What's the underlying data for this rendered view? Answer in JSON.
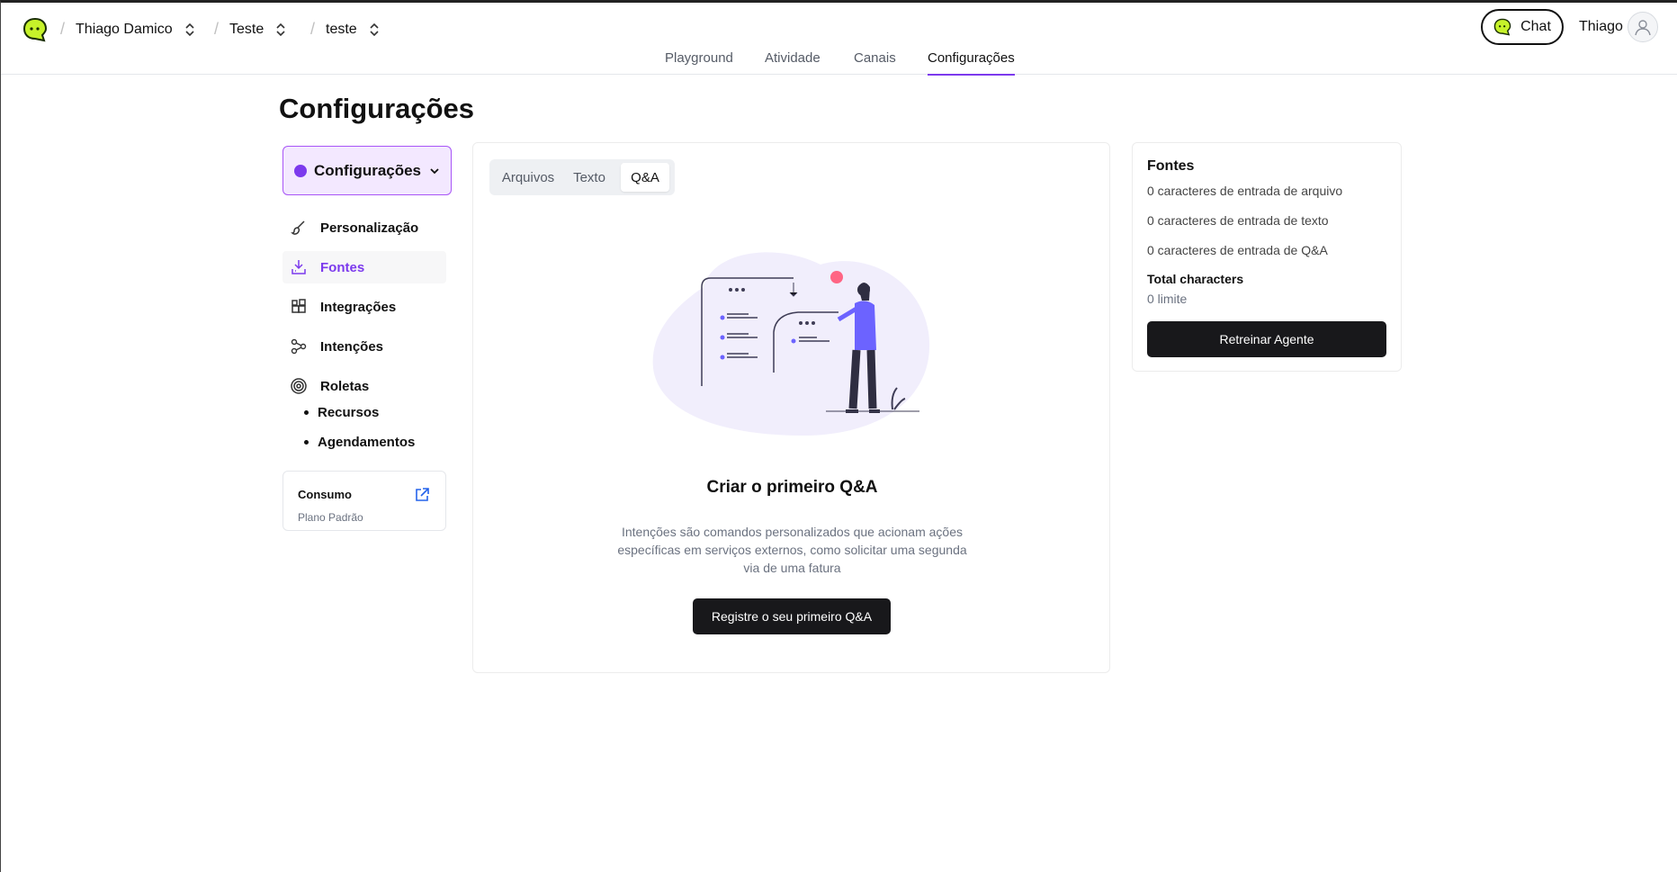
{
  "header": {
    "breadcrumbs": [
      {
        "label": "Thiago Damico"
      },
      {
        "label": "Teste"
      },
      {
        "label": "teste"
      }
    ],
    "nav_tabs": [
      {
        "label": "Playground"
      },
      {
        "label": "Atividade"
      },
      {
        "label": "Canais"
      },
      {
        "label": "Configurações",
        "active": true
      }
    ],
    "chat_label": "Chat",
    "user_name": "Thiago",
    "accent_color": "#7c3aed",
    "logo_color": "#c6f22a"
  },
  "page": {
    "title": "Configurações"
  },
  "sidebar": {
    "agent_selector": "Configurações",
    "items": [
      {
        "label": "Personalização",
        "icon": "brush-icon"
      },
      {
        "label": "Fontes",
        "icon": "download-tray-icon",
        "active": true
      },
      {
        "label": "Integrações",
        "icon": "blocks-icon"
      },
      {
        "label": "Intenções",
        "icon": "workflow-icon"
      },
      {
        "label": "Roletas",
        "icon": "target-icon"
      }
    ],
    "sub_items": [
      {
        "label": "Recursos"
      },
      {
        "label": "Agendamentos"
      }
    ],
    "consumo": {
      "title": "Consumo",
      "plan": "Plano Padrão"
    }
  },
  "main": {
    "tabs": [
      {
        "label": "Arquivos"
      },
      {
        "label": "Texto"
      },
      {
        "label": "Q&A",
        "active": true
      }
    ],
    "empty_title": "Criar o primeiro Q&A",
    "empty_description": "Intenções são comandos personalizados que acionam ações específicas em serviços externos, como solicitar uma segunda via de uma fatura",
    "cta_label": "Registre o seu primeiro Q&A"
  },
  "sources": {
    "title": "Fontes",
    "lines": [
      "0 caracteres de entrada de arquivo",
      "0 caracteres de entrada de texto",
      "0 caracteres de entrada de Q&A"
    ],
    "total_label": "Total characters",
    "limit_label": "0 limite",
    "retrain_label": "Retreinar Agente"
  }
}
